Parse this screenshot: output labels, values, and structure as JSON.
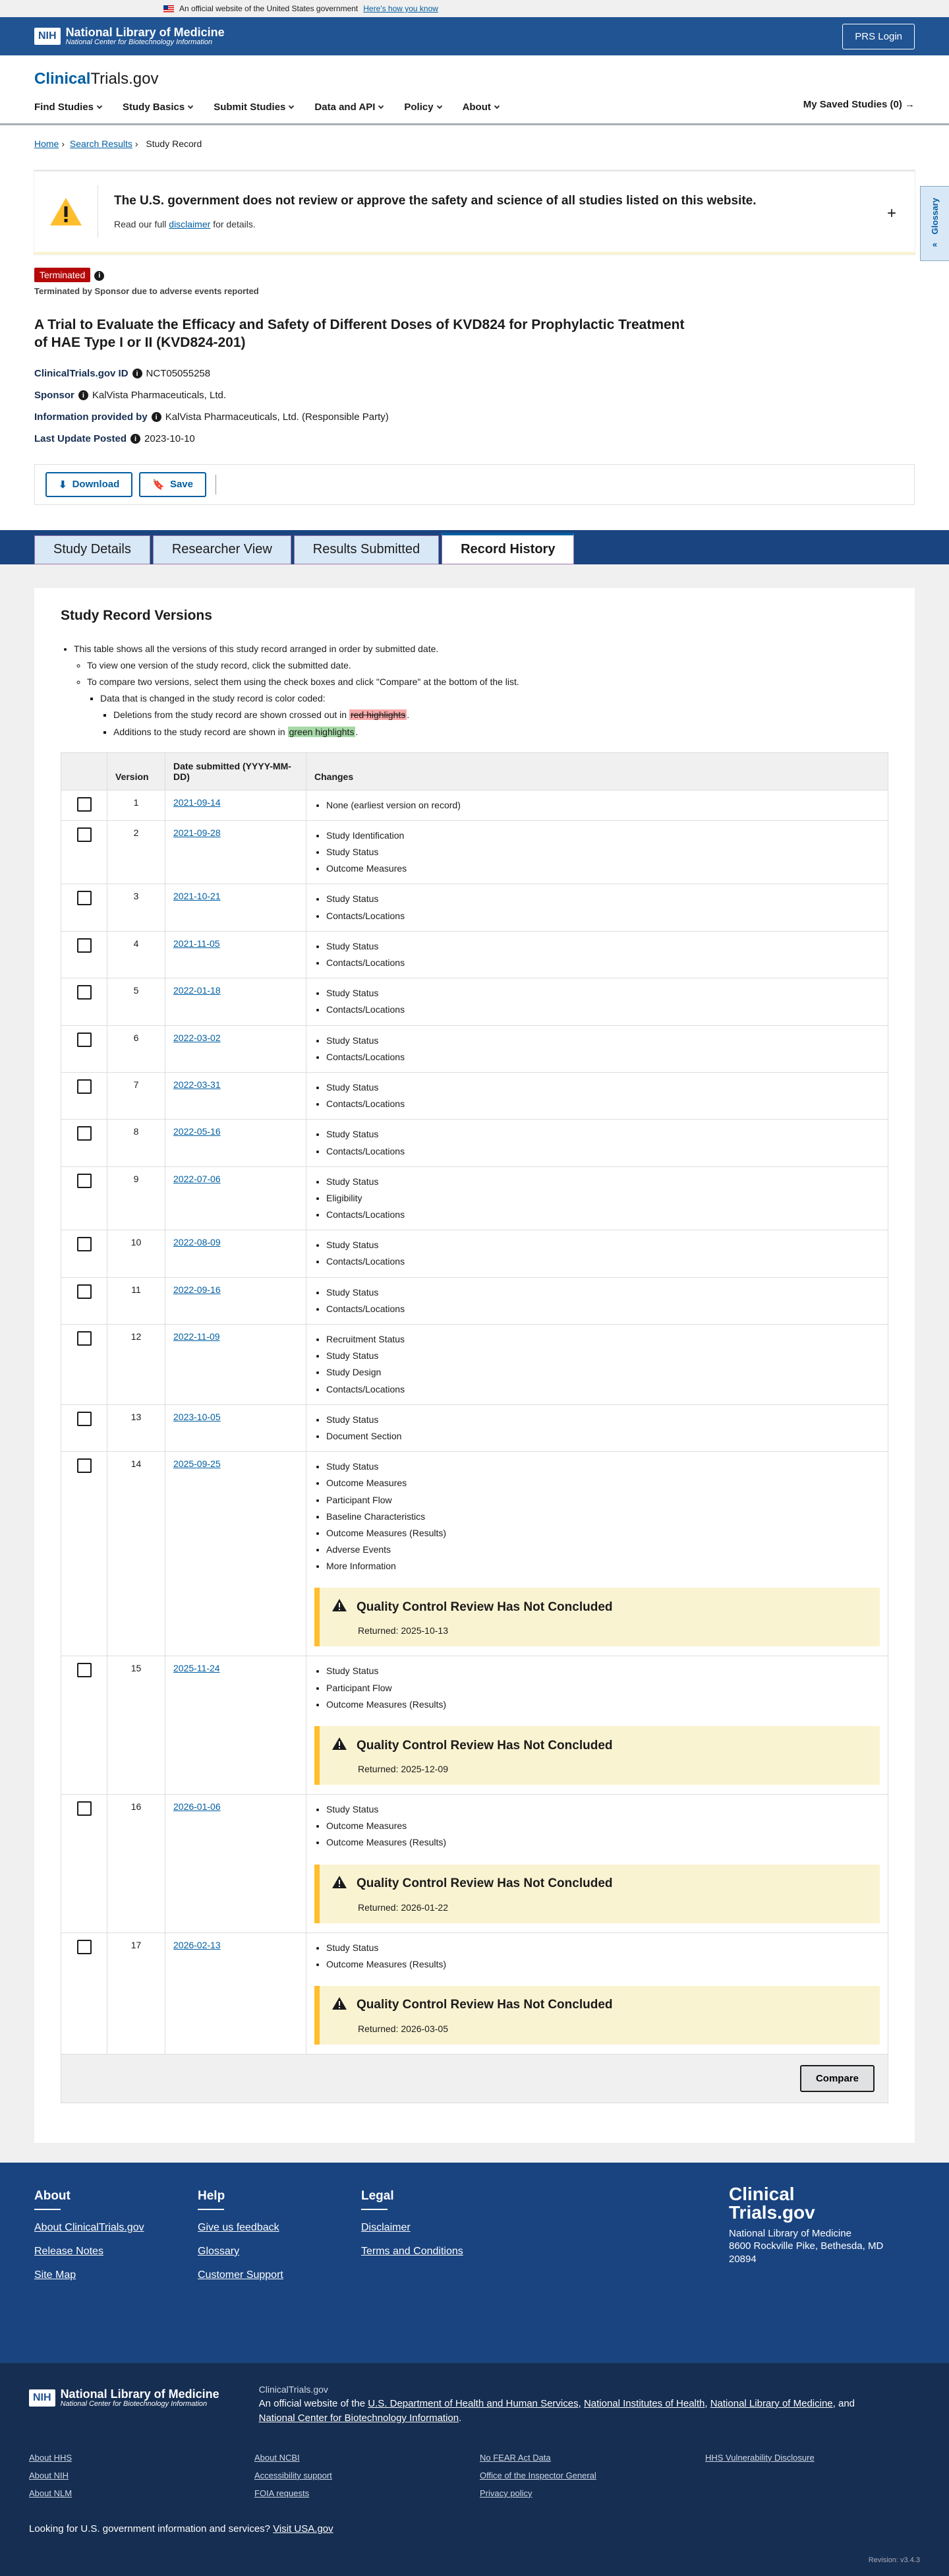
{
  "gov_banner": {
    "text": "An official website of the United States government",
    "link": "Here's how you know"
  },
  "nlm": {
    "nih": "NIH",
    "name": "National Library of Medicine",
    "sub": "National Center for Biotechnology Information",
    "prs_login": "PRS Login"
  },
  "site": {
    "logo_a": "Clinical",
    "logo_b": "Trials.gov",
    "nav": [
      "Find Studies",
      "Study Basics",
      "Submit Studies",
      "Data and API",
      "Policy",
      "About"
    ],
    "saved": "My Saved Studies (0)"
  },
  "glossary": "Glossary",
  "breadcrumb": [
    "Home",
    "Search Results",
    "Study Record"
  ],
  "notice": {
    "title": "The U.S. government does not review or approve the safety and science of all studies listed on this website.",
    "sub_a": "Read our full",
    "sub_link": "disclaimer",
    "sub_b": "for details."
  },
  "study": {
    "status": "Terminated",
    "reason": "Terminated by Sponsor due to adverse events reported",
    "title": "A Trial to Evaluate the Efficacy and Safety of Different Doses of KVD824 for Prophylactic Treatment of HAE Type I or II (KVD824-201)",
    "id_label": "ClinicalTrials.gov ID",
    "id": "NCT05055258",
    "sponsor_label": "Sponsor",
    "sponsor": "KalVista Pharmaceuticals, Ltd.",
    "info_label": "Information provided by",
    "info": "KalVista Pharmaceuticals, Ltd. (Responsible Party)",
    "update_label": "Last Update Posted",
    "update": "2023-10-10"
  },
  "actions": {
    "download": "Download",
    "save": "Save"
  },
  "tabs": [
    "Study Details",
    "Researcher View",
    "Results Submitted",
    "Record History"
  ],
  "history": {
    "heading": "Study Record Versions",
    "d1": "This table shows all the versions of this study record arranged in order by submitted date.",
    "d2": "To view one version of the study record, click the submitted date.",
    "d3": "To compare two versions, select them using the check boxes and click \"Compare\" at the bottom of the list.",
    "d4": "Data that is changed in the study record is color coded:",
    "d5a": "Deletions from the study record are shown crossed out in",
    "d5b": "red highlights",
    "d6a": "Additions to the study record are shown in",
    "d6b": "green highlights",
    "col_version": "Version",
    "col_date": "Date submitted (YYYY-MM-DD)",
    "col_changes": "Changes",
    "compare": "Compare",
    "qc_title": "Quality Control Review Has Not Concluded",
    "qc_prefix": "Returned: ",
    "rows": [
      {
        "v": "1",
        "date": "2021-09-14",
        "changes": [
          "None (earliest version on record)"
        ]
      },
      {
        "v": "2",
        "date": "2021-09-28",
        "changes": [
          "Study Identification",
          "Study Status",
          "Outcome Measures"
        ]
      },
      {
        "v": "3",
        "date": "2021-10-21",
        "changes": [
          "Study Status",
          "Contacts/Locations"
        ]
      },
      {
        "v": "4",
        "date": "2021-11-05",
        "changes": [
          "Study Status",
          "Contacts/Locations"
        ]
      },
      {
        "v": "5",
        "date": "2022-01-18",
        "changes": [
          "Study Status",
          "Contacts/Locations"
        ]
      },
      {
        "v": "6",
        "date": "2022-03-02",
        "changes": [
          "Study Status",
          "Contacts/Locations"
        ]
      },
      {
        "v": "7",
        "date": "2022-03-31",
        "changes": [
          "Study Status",
          "Contacts/Locations"
        ]
      },
      {
        "v": "8",
        "date": "2022-05-16",
        "changes": [
          "Study Status",
          "Contacts/Locations"
        ]
      },
      {
        "v": "9",
        "date": "2022-07-06",
        "changes": [
          "Study Status",
          "Eligibility",
          "Contacts/Locations"
        ]
      },
      {
        "v": "10",
        "date": "2022-08-09",
        "changes": [
          "Study Status",
          "Contacts/Locations"
        ]
      },
      {
        "v": "11",
        "date": "2022-09-16",
        "changes": [
          "Study Status",
          "Contacts/Locations"
        ]
      },
      {
        "v": "12",
        "date": "2022-11-09",
        "changes": [
          "Recruitment Status",
          "Study Status",
          "Study Design",
          "Contacts/Locations"
        ]
      },
      {
        "v": "13",
        "date": "2023-10-05",
        "changes": [
          "Study Status",
          "Document Section"
        ]
      },
      {
        "v": "14",
        "date": "2025-09-25",
        "changes": [
          "Study Status",
          "Outcome Measures",
          "Participant Flow",
          "Baseline Characteristics",
          "Outcome Measures (Results)",
          "Adverse Events",
          "More Information"
        ],
        "qc": "2025-10-13"
      },
      {
        "v": "15",
        "date": "2025-11-24",
        "changes": [
          "Study Status",
          "Participant Flow",
          "Outcome Measures (Results)"
        ],
        "qc": "2025-12-09"
      },
      {
        "v": "16",
        "date": "2026-01-06",
        "changes": [
          "Study Status",
          "Outcome Measures",
          "Outcome Measures (Results)"
        ],
        "qc": "2026-01-22"
      },
      {
        "v": "17",
        "date": "2026-02-13",
        "changes": [
          "Study Status",
          "Outcome Measures (Results)"
        ],
        "qc": "2026-03-05"
      }
    ]
  },
  "footer": {
    "cols": [
      {
        "h": "About",
        "links": [
          "About ClinicalTrials.gov",
          "Release Notes",
          "Site Map"
        ]
      },
      {
        "h": "Help",
        "links": [
          "Give us feedback",
          "Glossary",
          "Customer Support"
        ]
      },
      {
        "h": "Legal",
        "links": [
          "Disclaimer",
          "Terms and Conditions"
        ]
      }
    ],
    "logo_a": "Clinical",
    "logo_b": "Trials.gov",
    "addr1": "National Library of Medicine",
    "addr2": "8600 Rockville Pike, Bethesda, MD",
    "addr3": "20894",
    "site": "ClinicalTrials.gov",
    "official_a": "An official website of the",
    "hhs": "U.S. Department of Health and Human Services",
    "nih": "National Institutes of Health",
    "nlm": "National Library of Medicine",
    "ncbi": "National Center for Biotechnology Information",
    "links": [
      "About HHS",
      "About NCBI",
      "No FEAR Act Data",
      "HHS Vulnerability Disclosure",
      "About NIH",
      "Accessibility support",
      "Office of the Inspector General",
      "",
      "About NLM",
      "FOIA requests",
      "Privacy policy",
      ""
    ],
    "usa_q": "Looking for U.S. government information and services?",
    "usa_link": "Visit USA.gov",
    "revision": "Revision: v3.4.3"
  }
}
